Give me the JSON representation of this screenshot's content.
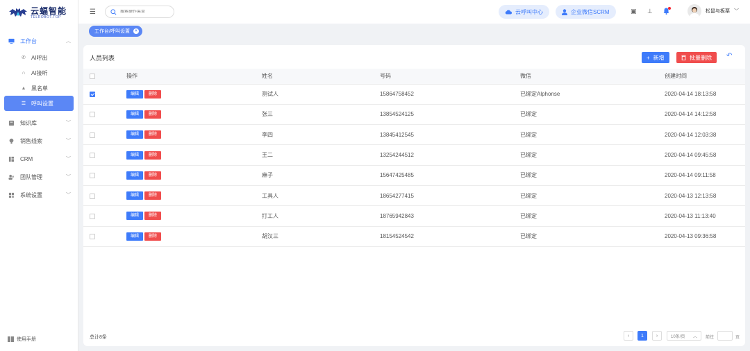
{
  "app": {
    "logo_cn": "云蝠智能",
    "logo_en": "TELROBOT.TOP",
    "accent": "#3e7bfa",
    "danger": "#f04d4d"
  },
  "sidebar": {
    "group_workbench": "工作台",
    "sub_items": [
      {
        "label": "AI呼出",
        "icon": "phone-icon"
      },
      {
        "label": "AI接听",
        "icon": "headset-icon"
      },
      {
        "label": "黑名单",
        "icon": "warning-icon"
      },
      {
        "label": "呼叫设置",
        "icon": "sliders-icon"
      }
    ],
    "groups": [
      {
        "label": "知识库",
        "icon": "book-icon"
      },
      {
        "label": "销售线索",
        "icon": "bulb-icon"
      },
      {
        "label": "CRM",
        "icon": "crm-icon"
      },
      {
        "label": "团队管理",
        "icon": "team-icon"
      },
      {
        "label": "系统设置",
        "icon": "settings-icon"
      }
    ],
    "manual": "使用手册"
  },
  "header": {
    "search_placeholder": "搜索操作菜单",
    "cloud_center": "云呼叫中心",
    "wechat_scrm": "企业微信SCRM",
    "user_name": "松鼠与板栗"
  },
  "tabs": {
    "active": "工作台/呼叫设置"
  },
  "card": {
    "title": "人员列表",
    "add_label": "新增",
    "batch_delete_label": "批量删除"
  },
  "table": {
    "columns": [
      "操作",
      "姓名",
      "号码",
      "微信",
      "创建时间"
    ],
    "edit_label": "编辑",
    "delete_label": "删除",
    "rows": [
      {
        "checked": true,
        "name": "测试人",
        "phone": "15864758452",
        "wechat": "已绑定Alphonse",
        "created": "2020-04-14  18:13:58"
      },
      {
        "checked": false,
        "name": "张三",
        "phone": "13854524125",
        "wechat": "已绑定",
        "created": "2020-04-14  14:12:58"
      },
      {
        "checked": false,
        "name": "李四",
        "phone": "13845412545",
        "wechat": "已绑定",
        "created": "2020-04-14  12:03:38"
      },
      {
        "checked": false,
        "name": "王二",
        "phone": "13254244512",
        "wechat": "已绑定",
        "created": "2020-04-14  09:45:58"
      },
      {
        "checked": false,
        "name": "麻子",
        "phone": "15647425485",
        "wechat": "已绑定",
        "created": "2020-04-14  09:11:58"
      },
      {
        "checked": false,
        "name": "工具人",
        "phone": "18654277415",
        "wechat": "已绑定",
        "created": "2020-04-13  12:13:58"
      },
      {
        "checked": false,
        "name": "打工人",
        "phone": "18765942843",
        "wechat": "已绑定",
        "created": "2020-04-13  11:13:40"
      },
      {
        "checked": false,
        "name": "胡汉三",
        "phone": "18154524542",
        "wechat": "已绑定",
        "created": "2020-04-13  09:36:58"
      }
    ]
  },
  "footer": {
    "total": "总计8条",
    "current_page": "1",
    "page_size": "10条/页",
    "goto_label": "前往",
    "page_unit": "页"
  }
}
